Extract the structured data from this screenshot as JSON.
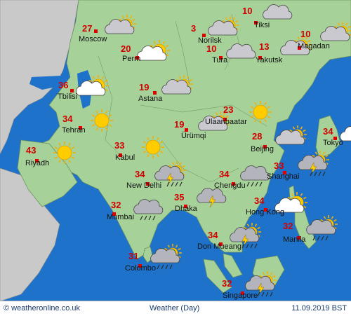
{
  "footer": {
    "site": "© weatheronline.co.uk",
    "title": "Weather (Day)",
    "date": "11.09.2019 BST"
  },
  "cities": [
    {
      "name": "Moscow",
      "temp": "27",
      "icon": "cloudy-sun"
    },
    {
      "name": "Perm",
      "temp": "20",
      "icon": "partly-cloudy-sun"
    },
    {
      "name": "Norilsk",
      "temp": "3",
      "icon": "cloudy-sun"
    },
    {
      "name": "Tiksi",
      "temp": "10",
      "icon": "cloudy"
    },
    {
      "name": "Tura",
      "temp": "10",
      "icon": "cloudy"
    },
    {
      "name": "Yakutsk",
      "temp": "13",
      "icon": "cloudy-sun"
    },
    {
      "name": "Magadan",
      "temp": "10",
      "icon": "cloudy-sun"
    },
    {
      "name": "Tbilisi",
      "temp": "36",
      "icon": "partly-cloudy-sun"
    },
    {
      "name": "Astana",
      "temp": "19",
      "icon": "cloudy-sun"
    },
    {
      "name": "Tehran",
      "temp": "34",
      "icon": "sun"
    },
    {
      "name": "Ulaanbaatar",
      "temp": "23",
      "icon": "sun"
    },
    {
      "name": "Ürümqi",
      "temp": "19",
      "icon": "cloudy-sun"
    },
    {
      "name": "Riyadh",
      "temp": "43",
      "icon": "sun"
    },
    {
      "name": "Kabul",
      "temp": "33",
      "icon": "sun"
    },
    {
      "name": "Beijing",
      "temp": "28",
      "icon": "cloudy-sun"
    },
    {
      "name": "Tokyo",
      "temp": "34",
      "icon": "partly-cloudy-sun"
    },
    {
      "name": "New Delhi",
      "temp": "34",
      "icon": "thunderstorm-sun"
    },
    {
      "name": "Chengdu",
      "temp": "34",
      "icon": "rain-cloud"
    },
    {
      "name": "Shanghai",
      "temp": "33",
      "icon": "thunderstorm-sun"
    },
    {
      "name": "Mumbai",
      "temp": "32",
      "icon": "rain-cloud"
    },
    {
      "name": "Dhaka",
      "temp": "35",
      "icon": "thunderstorm"
    },
    {
      "name": "Hong Kong",
      "temp": "34",
      "icon": "partly-cloudy-sun"
    },
    {
      "name": "Manila",
      "temp": "32",
      "icon": "rain-sun"
    },
    {
      "name": "Don Mueang",
      "temp": "34",
      "icon": "thunderstorm-sun"
    },
    {
      "name": "Colombo",
      "temp": "31",
      "icon": "rain-sun"
    },
    {
      "name": "Singapore",
      "temp": "32",
      "icon": "thunderstorm-sun"
    }
  ],
  "colors": {
    "sea": "#1f72c9",
    "land": "#a6d29a",
    "foreign_land": "#c9c9c9",
    "temp_text": "#d30000"
  }
}
